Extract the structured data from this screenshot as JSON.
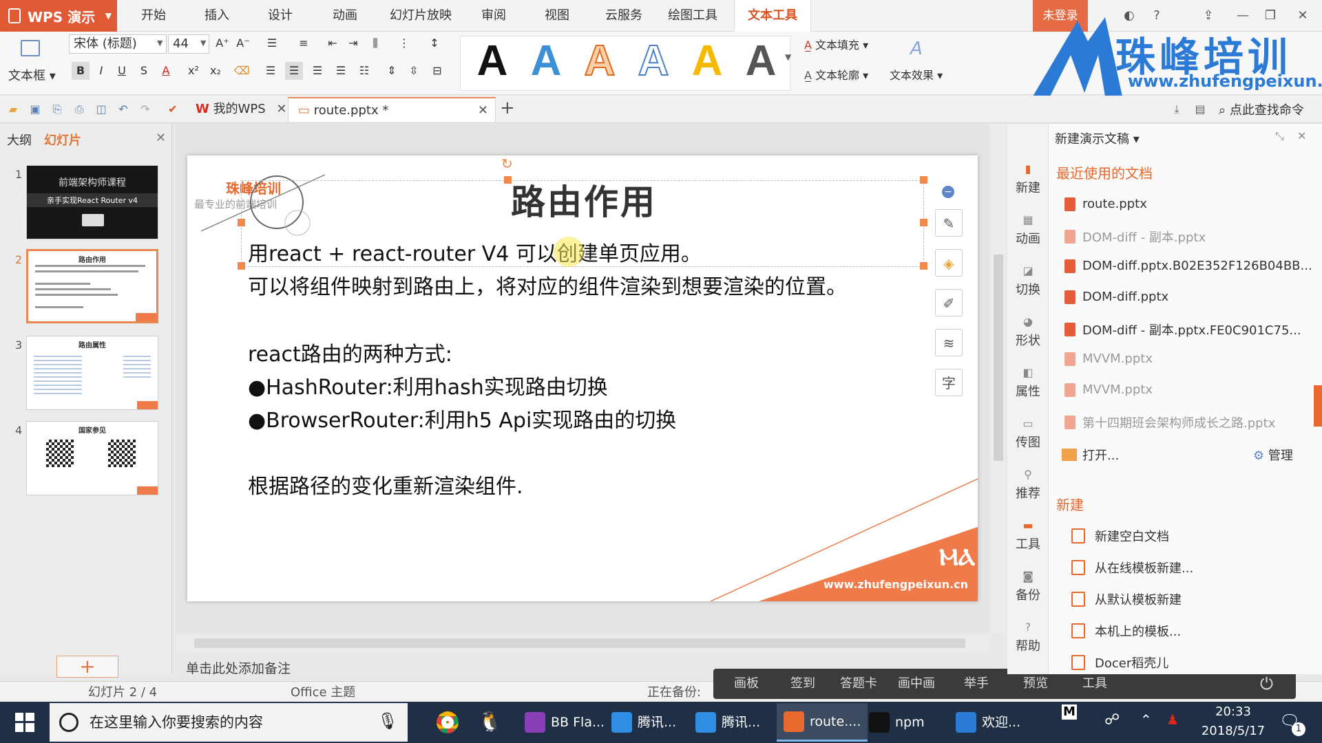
{
  "app": {
    "brand": "WPS 演示",
    "login": "未登录"
  },
  "menu": {
    "items": [
      "开始",
      "插入",
      "设计",
      "动画",
      "幻灯片放映",
      "审阅",
      "视图",
      "云服务",
      "绘图工具",
      "文本工具"
    ],
    "active": "文本工具"
  },
  "ribbon": {
    "textbox": "文本框",
    "font_name": "宋体 (标题)",
    "font_size": "44",
    "fill": "文本填充",
    "outline": "文本轮廓",
    "effect": "文本效果",
    "styles": [
      {
        "letter": "A",
        "color": "#111111"
      },
      {
        "letter": "A",
        "color": "#3d8fd6"
      },
      {
        "letter": "A",
        "color": "#f08a3c"
      },
      {
        "letter": "A",
        "color": "#4a7fc9"
      },
      {
        "letter": "A",
        "color": "#f6b900"
      },
      {
        "letter": "A",
        "color": "#555555"
      }
    ]
  },
  "watermark": {
    "brand": "珠峰培训",
    "url": "www.zhufengpeixun.cn"
  },
  "tabs": {
    "my_wps": "我的WPS",
    "doc": "route.pptx *",
    "search_cmd": "点此查找命令"
  },
  "left_pane": {
    "outline_tab": "大纲",
    "slides_tab": "幻灯片",
    "thumbs": [
      {
        "num": "1",
        "title": "前端架构师课程",
        "sub": "亲手实现React Router v4"
      },
      {
        "num": "2",
        "title": "路由作用"
      },
      {
        "num": "3",
        "title": "路由属性"
      },
      {
        "num": "4",
        "title": "国家参见"
      }
    ]
  },
  "slide": {
    "logo_cn": "珠峰培训",
    "logo_sub": "最专业的前端培训",
    "title": "路由作用",
    "line1": "用react + react-router V4 可以创建单页应用。",
    "line2": "可以将组件映射到路由上，将对应的组件渲染到想要渲染的位置。",
    "line3": "react路由的两种方式:",
    "line4": "●HashRouter:利用hash实现路由切换",
    "line5": "●BrowserRouter:利用h5 Api实现路由的切换",
    "line6": "根据路径的变化重新渲染组件.",
    "footer_url": "www.zhufengpeixun.cn"
  },
  "notes": "单击此处添加备注",
  "status": {
    "slide_info": "幻灯片 2 / 4",
    "theme": "Office 主题",
    "backup": "正在备份:"
  },
  "review_bar": [
    "画板",
    "签到",
    "答题卡",
    "画中画",
    "举手",
    "预览",
    "工具"
  ],
  "right_panel": {
    "title": "新建演示文稿",
    "icons": [
      "新建",
      "动画",
      "切换",
      "形状",
      "属性",
      "传图",
      "推荐",
      "工具",
      "备份",
      "帮助"
    ],
    "recent_head": "最近使用的文档",
    "recent": [
      {
        "name": "route.pptx",
        "dim": false
      },
      {
        "name": "DOM-diff - 副本.pptx",
        "dim": true
      },
      {
        "name": "DOM-diff.pptx.B02E352F126B04BB...",
        "dim": false
      },
      {
        "name": "DOM-diff.pptx",
        "dim": false
      },
      {
        "name": "DOM-diff - 副本.pptx.FE0C901C75...",
        "dim": false
      },
      {
        "name": "MVVM.pptx",
        "dim": true
      },
      {
        "name": "MVVM.pptx",
        "dim": true
      },
      {
        "name": "第十四期班会架构师成长之路.pptx",
        "dim": true
      }
    ],
    "open": "打开...",
    "manage": "管理",
    "new_head": "新建",
    "new_items": [
      "新建空白文档",
      "从在线模板新建...",
      "从默认模板新建",
      "本机上的模板...",
      "Docer稻壳儿"
    ]
  },
  "taskbar": {
    "search_placeholder": "在这里输入你要搜索的内容",
    "apps": [
      "BB Fla...",
      "腾讯...",
      "腾讯...",
      "route....",
      "npm",
      "欢迎..."
    ],
    "time": "20:33",
    "date": "2018/5/17"
  }
}
